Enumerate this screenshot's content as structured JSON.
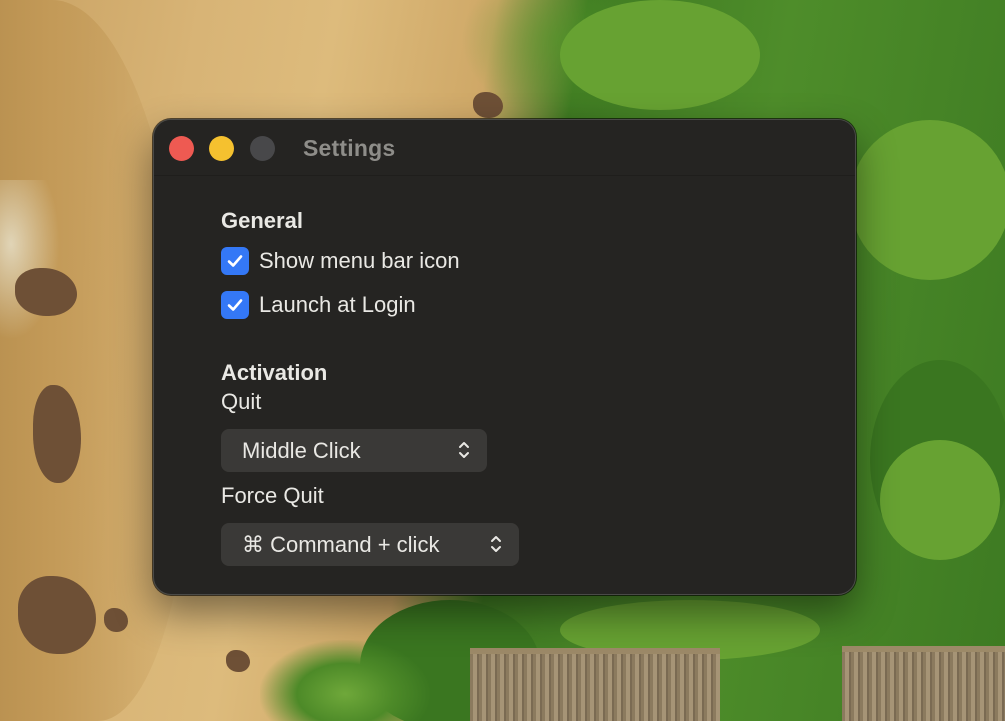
{
  "window": {
    "title": "Settings"
  },
  "general": {
    "heading": "General",
    "show_menu_bar_icon": {
      "label": "Show menu bar icon",
      "checked": true
    },
    "launch_at_login": {
      "label": "Launch at Login",
      "checked": true
    }
  },
  "activation": {
    "heading": "Activation",
    "quit": {
      "label": "Quit",
      "selected": "Middle Click"
    },
    "force_quit": {
      "label": "Force Quit",
      "selected": "⌘ Command + click"
    }
  },
  "colors": {
    "window_bg": "#252422",
    "checkbox_accent": "#3478f6",
    "close": "#ee5a52",
    "minimize": "#f5c12f",
    "zoom_disabled": "#48484a"
  },
  "icons": [
    "checkmark-icon",
    "updown-chevron-icon"
  ]
}
